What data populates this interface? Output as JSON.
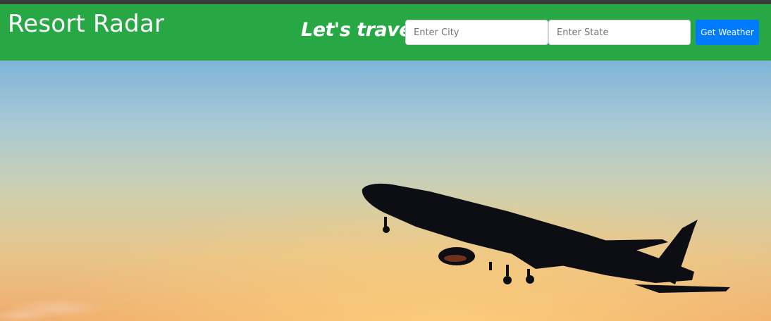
{
  "navbar": {
    "brand": "Resort Radar",
    "tagline": "Let's travel!",
    "city_placeholder": "Enter City",
    "state_placeholder": "Enter State",
    "button_label": "Get Weather"
  },
  "hero": {
    "image": "airplane-takeoff-sunset",
    "colors": {
      "sky_top": "#86b7d6",
      "sky_mid": "#bfcdbf",
      "sky_low": "#e8c48a",
      "horizon": "#f3b66c",
      "navbar": "#28a745",
      "button": "#007bff"
    }
  }
}
